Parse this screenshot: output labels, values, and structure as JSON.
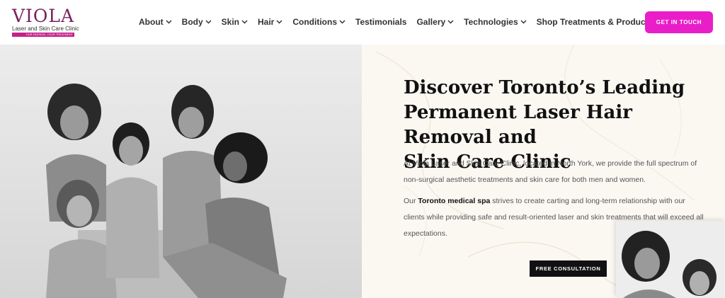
{
  "logo": {
    "word": "VIOLA",
    "subtitle": "Laser and Skin Care Clinic",
    "tagline": "OUR PASSION, YOUR TREATMENT"
  },
  "nav": {
    "items": [
      {
        "label": "About",
        "dropdown": true
      },
      {
        "label": "Body",
        "dropdown": true
      },
      {
        "label": "Skin",
        "dropdown": true
      },
      {
        "label": "Hair",
        "dropdown": true
      },
      {
        "label": "Conditions",
        "dropdown": true
      },
      {
        "label": "Testimonials",
        "dropdown": false
      },
      {
        "label": "Gallery",
        "dropdown": true
      },
      {
        "label": "Technologies",
        "dropdown": true
      },
      {
        "label": "Shop Treatments & Products",
        "dropdown": false
      }
    ]
  },
  "cta": {
    "label": "GET IN TOUCH"
  },
  "hero": {
    "headline_lines": [
      "Discover Toronto’s Leading",
      "Permanent Laser Hair Removal and",
      "Skin Care Clinic"
    ],
    "para1": "At Viola Laser and Skin Care Clinic, located in North York, we provide the full spectrum of non-surgical aesthetic treatments and skin care for both men and women.",
    "para2_prefix": "Our ",
    "para2_bold": "Toronto medical spa",
    "para2_suffix": " strives to create carting and long-term relationship with our clients while providing safe and result-oriented laser and skin treatments that will exceed all expectations.",
    "button": "FREE CONSULTATION"
  },
  "colors": {
    "brand_magenta": "#e91ec8",
    "logo_purple": "#7a1f5c",
    "dark_button": "#111111"
  }
}
